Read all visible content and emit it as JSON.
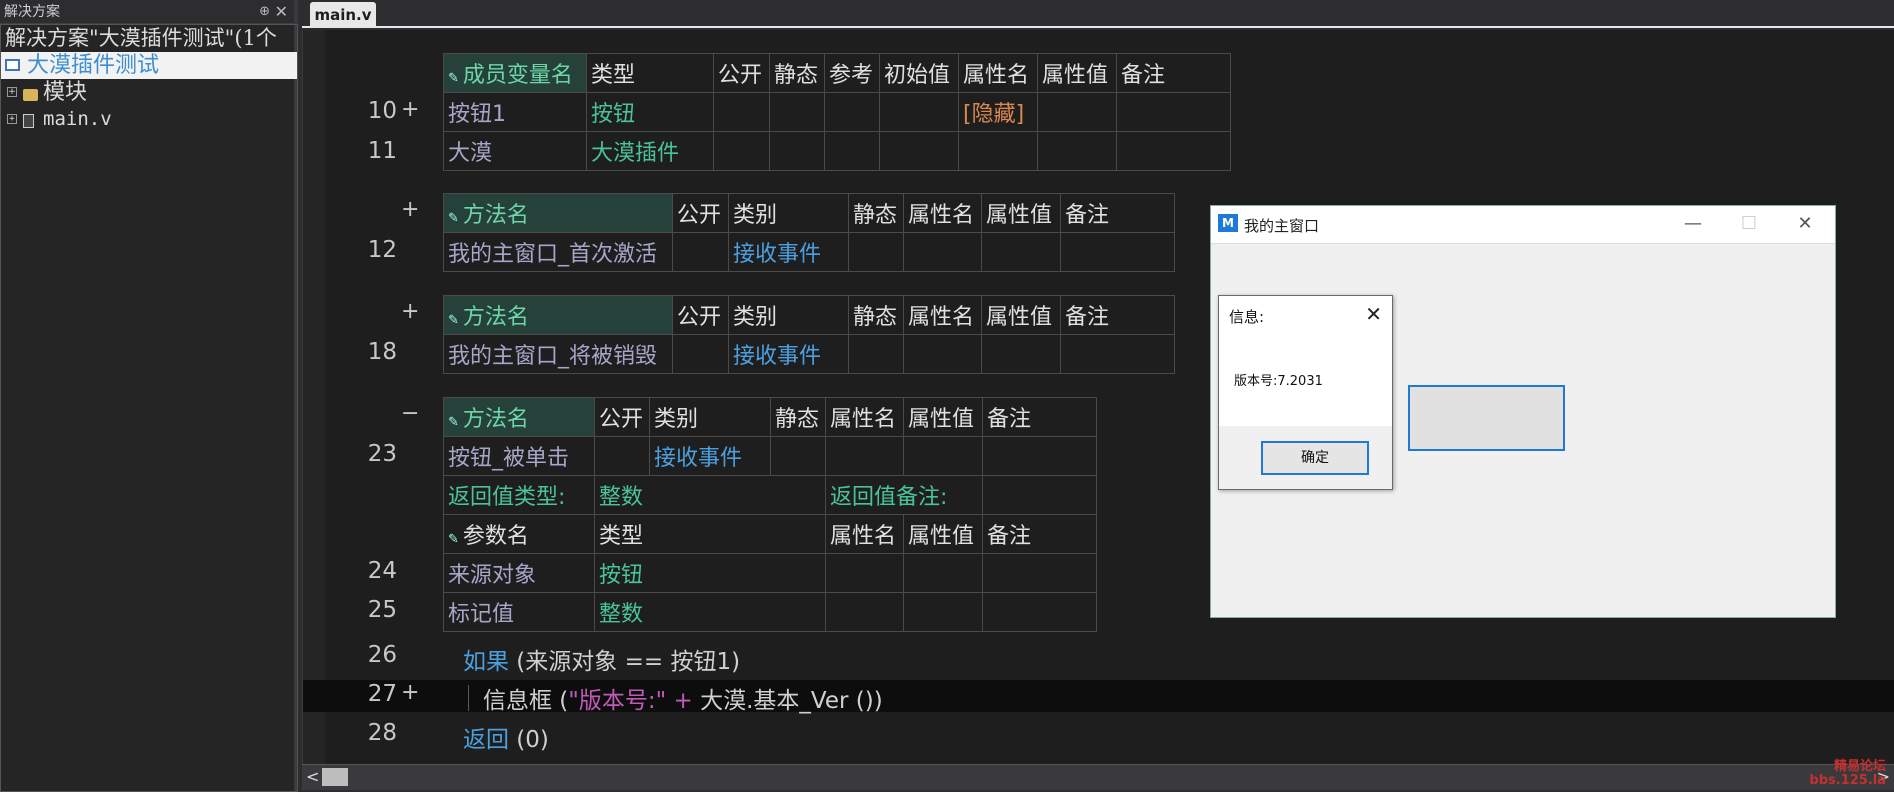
{
  "solution_panel": {
    "title": "解决方案",
    "pin_icon": "⊕",
    "close_icon": "✕",
    "solution_label": "解决方案\"大漠插件测试\"(1个",
    "project_label": "大漠插件测试",
    "items": [
      {
        "label": "模块",
        "icon": "folder-icon",
        "expander": "+"
      },
      {
        "label": "main.v",
        "icon": "file-icon",
        "expander": "+"
      }
    ]
  },
  "editor": {
    "tab_label": "main.v",
    "members_table": {
      "headers": [
        "成员变量名",
        "类型",
        "公开",
        "静态",
        "参考",
        "初始值",
        "属性名",
        "属性值",
        "备注"
      ],
      "rows": [
        {
          "line": "10",
          "mark": "+",
          "cells": [
            "按钮1",
            "按钮",
            "",
            "",
            "",
            "",
            "[隐藏]",
            "",
            ""
          ]
        },
        {
          "line": "11",
          "mark": "",
          "cells": [
            "大漠",
            "大漠插件",
            "",
            "",
            "",
            "",
            "",
            "",
            ""
          ]
        }
      ]
    },
    "method1": {
      "mark": "+",
      "headers": [
        "方法名",
        "公开",
        "类别",
        "静态",
        "属性名",
        "属性值",
        "备注"
      ],
      "line": "12",
      "cells": [
        "我的主窗口_首次激活",
        "",
        "接收事件",
        "",
        "",
        "",
        ""
      ]
    },
    "method2": {
      "mark": "+",
      "headers": [
        "方法名",
        "公开",
        "类别",
        "静态",
        "属性名",
        "属性值",
        "备注"
      ],
      "line": "18",
      "cells": [
        "我的主窗口_将被销毁",
        "",
        "接收事件",
        "",
        "",
        "",
        ""
      ]
    },
    "method3": {
      "mark": "−",
      "headers": [
        "方法名",
        "公开",
        "类别",
        "静态",
        "属性名",
        "属性值",
        "备注"
      ],
      "line": "23",
      "cells": [
        "按钮_被单击",
        "",
        "接收事件",
        "",
        "",
        "",
        ""
      ],
      "return_type_label": "返回值类型:",
      "return_type": "整数",
      "return_note_label": "返回值备注:",
      "param_headers": [
        "参数名",
        "类型",
        "属性名",
        "属性值",
        "备注"
      ],
      "params": [
        {
          "line": "24",
          "name": "来源对象",
          "type": "按钮"
        },
        {
          "line": "25",
          "name": "标记值",
          "type": "整数"
        }
      ]
    },
    "code": [
      {
        "line": "26",
        "mark": "",
        "kw": "如果",
        "rest": " (来源对象 == 按钮1)"
      },
      {
        "line": "27",
        "mark": "+",
        "fn": "信息框 (",
        "str": "\"版本号:\"",
        "op": " + ",
        "rest": "大漠.基本_Ver ())"
      },
      {
        "line": "28",
        "mark": "",
        "kw": "返回",
        "rest": " (0)"
      }
    ]
  },
  "scrollbar": {
    "left_arrow": "<",
    "right_arrow": ">"
  },
  "app_window": {
    "title": "我的主窗口",
    "logo_text": "M",
    "min_icon": "—",
    "max_icon": "☐",
    "close_icon": "✕"
  },
  "message_box": {
    "title": "信息:",
    "close_icon": "✕",
    "text": "版本号:7.2031",
    "ok_label": "确定"
  },
  "watermark": {
    "line1": "精易论坛",
    "line2": "bbs.125.la"
  },
  "colors": {
    "accent": "#1e7ad6",
    "type_green": "#49c39a",
    "keyword_blue": "#4ca0e0",
    "string_magenta": "#c05ab8"
  }
}
